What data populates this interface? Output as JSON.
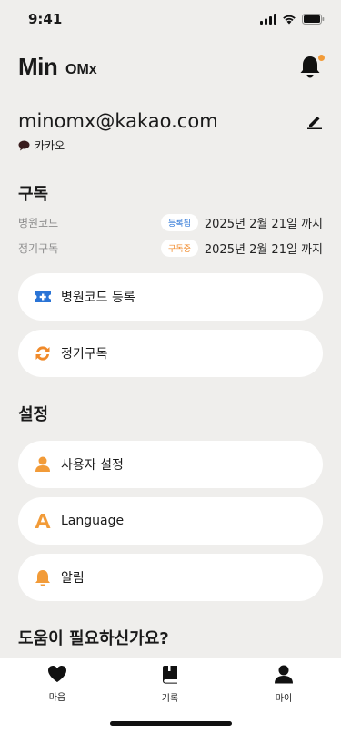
{
  "status": {
    "time": "9:41"
  },
  "header": {
    "logo": "Min",
    "logo_sub": "OMx"
  },
  "account": {
    "email": "minomx@kakao.com",
    "provider": "카카오"
  },
  "subscription": {
    "title": "구독",
    "rows": [
      {
        "label": "병원코드",
        "badge": "등록됨",
        "date": "2025년 2월 21일 까지"
      },
      {
        "label": "정기구독",
        "badge": "구독중",
        "date": "2025년 2월 21일 까지"
      }
    ],
    "actions": [
      {
        "label": "병원코드 등록",
        "icon": "ticket-plus-icon"
      },
      {
        "label": "정기구독",
        "icon": "refresh-icon"
      }
    ]
  },
  "settings": {
    "title": "설정",
    "items": [
      {
        "label": "사용자 설정",
        "icon": "user-icon"
      },
      {
        "label": "Language",
        "icon": "language-a-icon"
      },
      {
        "label": "알림",
        "icon": "bell-icon"
      }
    ]
  },
  "help": {
    "title": "도움이 필요하신가요?"
  },
  "tabs": [
    {
      "label": "마음",
      "icon": "heart-icon"
    },
    {
      "label": "기록",
      "icon": "book-icon"
    },
    {
      "label": "마이",
      "icon": "profile-icon"
    }
  ],
  "colors": {
    "accent": "#f29b38",
    "blue": "#2a74d6",
    "background": "#efeeec"
  }
}
